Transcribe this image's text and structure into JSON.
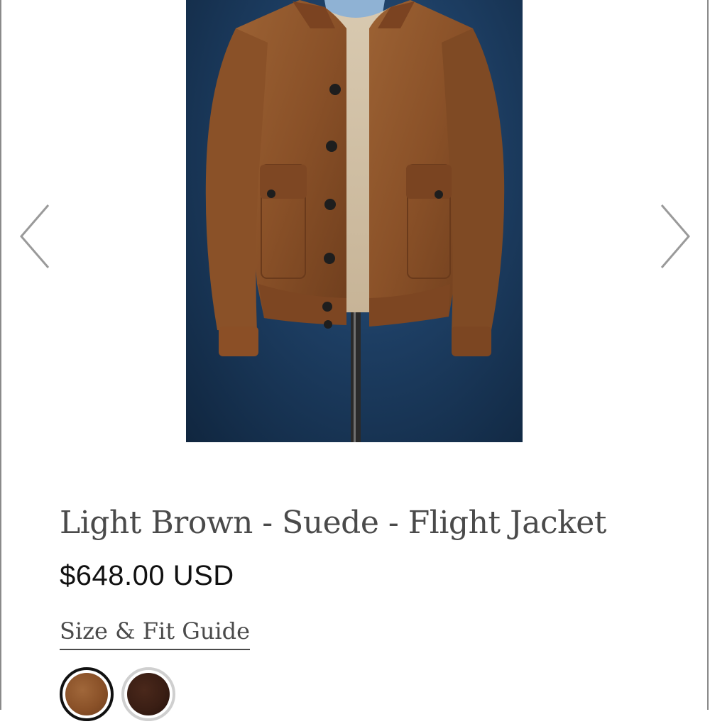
{
  "gallery": {
    "image_alt": "Light Brown Suede Flight Jacket on mannequin",
    "prev_icon": "chevron-left-icon",
    "next_icon": "chevron-right-icon"
  },
  "product": {
    "title": "Light Brown - Suede - Flight Jacket",
    "price": "$648.00 USD",
    "size_guide_label": "Size & Fit Guide"
  },
  "swatches": [
    {
      "name": "Light Brown",
      "color": "#8a5128",
      "selected": true
    },
    {
      "name": "Dark Brown",
      "color": "#3a1e14",
      "selected": false
    }
  ],
  "colors": {
    "title_text": "#4a4a4a",
    "price_text": "#111111",
    "arrow": "#9a9a9a",
    "image_backdrop": "#1d3e63"
  }
}
